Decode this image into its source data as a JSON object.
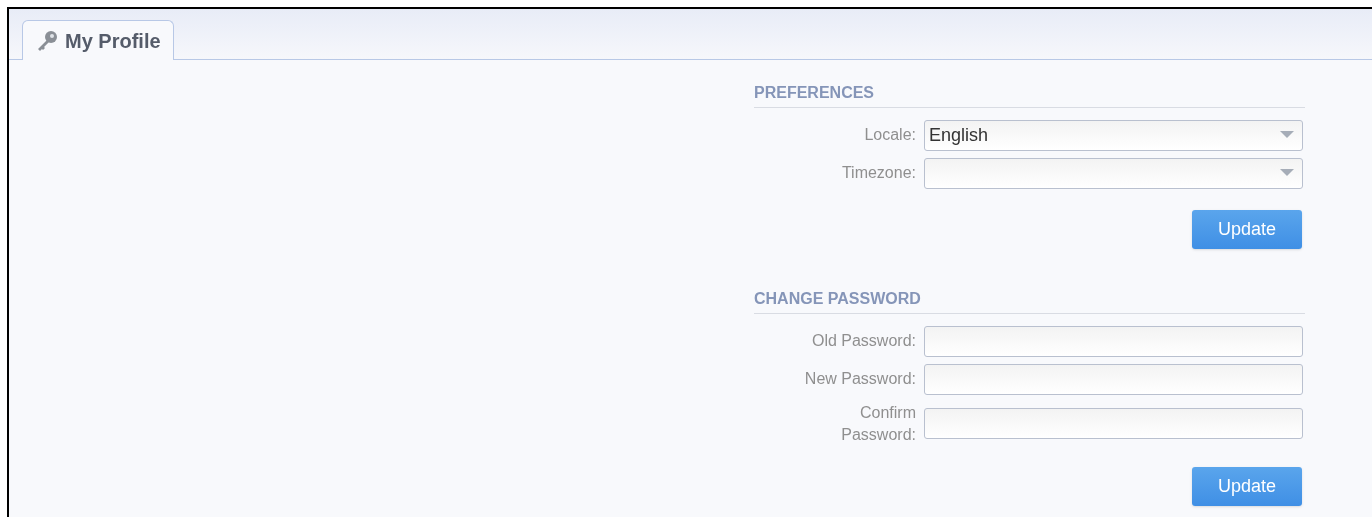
{
  "tabs": [
    {
      "label": "My Profile",
      "selected": true
    }
  ],
  "sections": [
    {
      "title": "PREFERENCES",
      "fields": [
        {
          "kind": "select",
          "label": "Locale:",
          "value": "English"
        },
        {
          "kind": "select",
          "label": "Timezone:"
        }
      ],
      "button": "Update"
    },
    {
      "title": "CHANGE PASSWORD",
      "fields": [
        {
          "kind": "password",
          "label": "Old Password:"
        },
        {
          "kind": "password",
          "label": "New Password:"
        },
        {
          "kind": "password",
          "label": "Confirm\nPassword:"
        }
      ],
      "button": "Update"
    }
  ]
}
